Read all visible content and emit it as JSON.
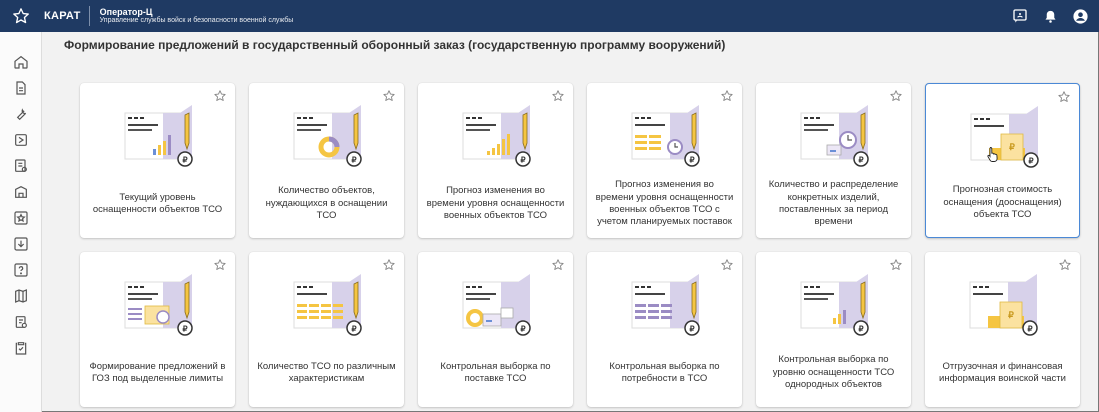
{
  "header": {
    "brand": "КАРАТ",
    "title": "Оператор-Ц",
    "subtitle": "Управление службы войск и безопасности военной службы"
  },
  "page": {
    "title": "Формирование предложений в государственный оборонный заказ (государственную программу вооружений)"
  },
  "sidebar": {
    "icons": [
      "home-icon",
      "document-icon",
      "wrench-icon",
      "report-icon",
      "table-icon",
      "building-icon",
      "star-box-icon",
      "download-icon",
      "help-icon",
      "map-icon",
      "clipboard-icon",
      "checklist-icon"
    ]
  },
  "colors": {
    "header_bg": "#1f3a63",
    "accent": "#4b89d6",
    "illustration_yellow": "#f5c542",
    "illustration_purple": "#d7d1ea"
  },
  "cards": [
    {
      "label": "Текущий уровень оснащенности объектов ТСО",
      "icon": "bar-chart-icon"
    },
    {
      "label": "Количество объектов, нуждающихся в оснащении ТСО",
      "icon": "donut-chart-icon"
    },
    {
      "label": "Прогноз изменения во времени уровня оснащенности военных объектов ТСО",
      "icon": "growth-chart-icon"
    },
    {
      "label": "Прогноз изменения во времени уровня оснащенности военных объектов ТСО с учетом планируемых поставок",
      "icon": "forecast-clock-icon"
    },
    {
      "label": "Количество и распределение конкретных изделий, поставленных за период времени",
      "icon": "delivery-clock-icon"
    },
    {
      "label": "Прогнозная стоимость оснащения (дооснащения) объекта ТСО",
      "icon": "cost-document-icon"
    },
    {
      "label": "Формирование предложений в ГОЗ под выделенные лимиты",
      "icon": "limits-clock-icon"
    },
    {
      "label": "Количество ТСО по различным характеристикам",
      "icon": "table-chart-icon"
    },
    {
      "label": "Контрольная выборка по поставке ТСО",
      "icon": "supply-box-icon"
    },
    {
      "label": "Контрольная выборка по потребности в ТСО",
      "icon": "need-table-icon"
    },
    {
      "label": "Контрольная выборка по уровню оснащенности ТСО однородных объектов",
      "icon": "uniform-chart-icon"
    },
    {
      "label": "Отгрузочная и финансовая информация воинской части",
      "icon": "finance-document-icon"
    }
  ]
}
